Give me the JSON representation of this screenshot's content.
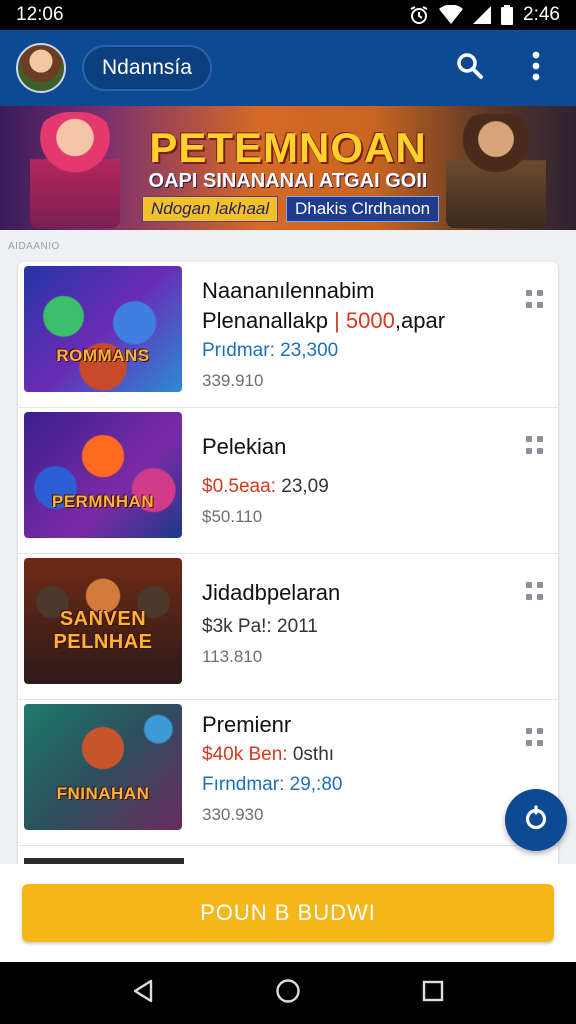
{
  "status_bar": {
    "time_left": "12:06",
    "time_right": "2:46"
  },
  "app_bar": {
    "region_label": "Ndannsía"
  },
  "banner": {
    "title": "PETEMNOAN",
    "subtitle": "OAPI SINANANAI ATGAI GOII",
    "tag_left": "Ndogan lakhaal",
    "tag_right": "Dhakis Clrdhanon"
  },
  "section_label": "AIDAANIO",
  "items": [
    {
      "thumb_label": "ROMMANS",
      "title": "Naananılennabim",
      "subtitle_prefix": "Plenanallakp",
      "subtitle_accent": "| 5000",
      "subtitle_suffix": ",apar",
      "price_label": "Prıdmar:",
      "price_value": "23,300",
      "meta": "339.910"
    },
    {
      "thumb_label": "PERMNHAN",
      "title": "Pelekian",
      "subtitle_prefix": "",
      "subtitle_accent": "",
      "subtitle_suffix": "",
      "price_label": "$0.5eaa:",
      "price_value": "23,09",
      "meta": "$50.110"
    },
    {
      "thumb_label": "SANVEN PELNHAE",
      "title": "Jidadbpelaran",
      "subtitle_prefix": "",
      "subtitle_accent": "",
      "subtitle_suffix": "",
      "price_label": "$3k Pa!:",
      "price_value": "2011",
      "meta": "113.810"
    },
    {
      "thumb_label": "FNINAHAN",
      "title": "Premienr",
      "subtitle_prefix": "",
      "subtitle_accent": "",
      "subtitle_suffix": "",
      "price_label": "$40k Ben:",
      "price_value": "0sthı",
      "meta_label": "Fırndmar:",
      "meta_value": "29,:80",
      "meta": "330.930"
    }
  ],
  "cta": {
    "label": "POUN B BUDWI"
  },
  "colors": {
    "primary": "#0d4a93",
    "accent": "#f6b71b",
    "price_red": "#d33a1f",
    "price_blue": "#1f6fb5"
  }
}
